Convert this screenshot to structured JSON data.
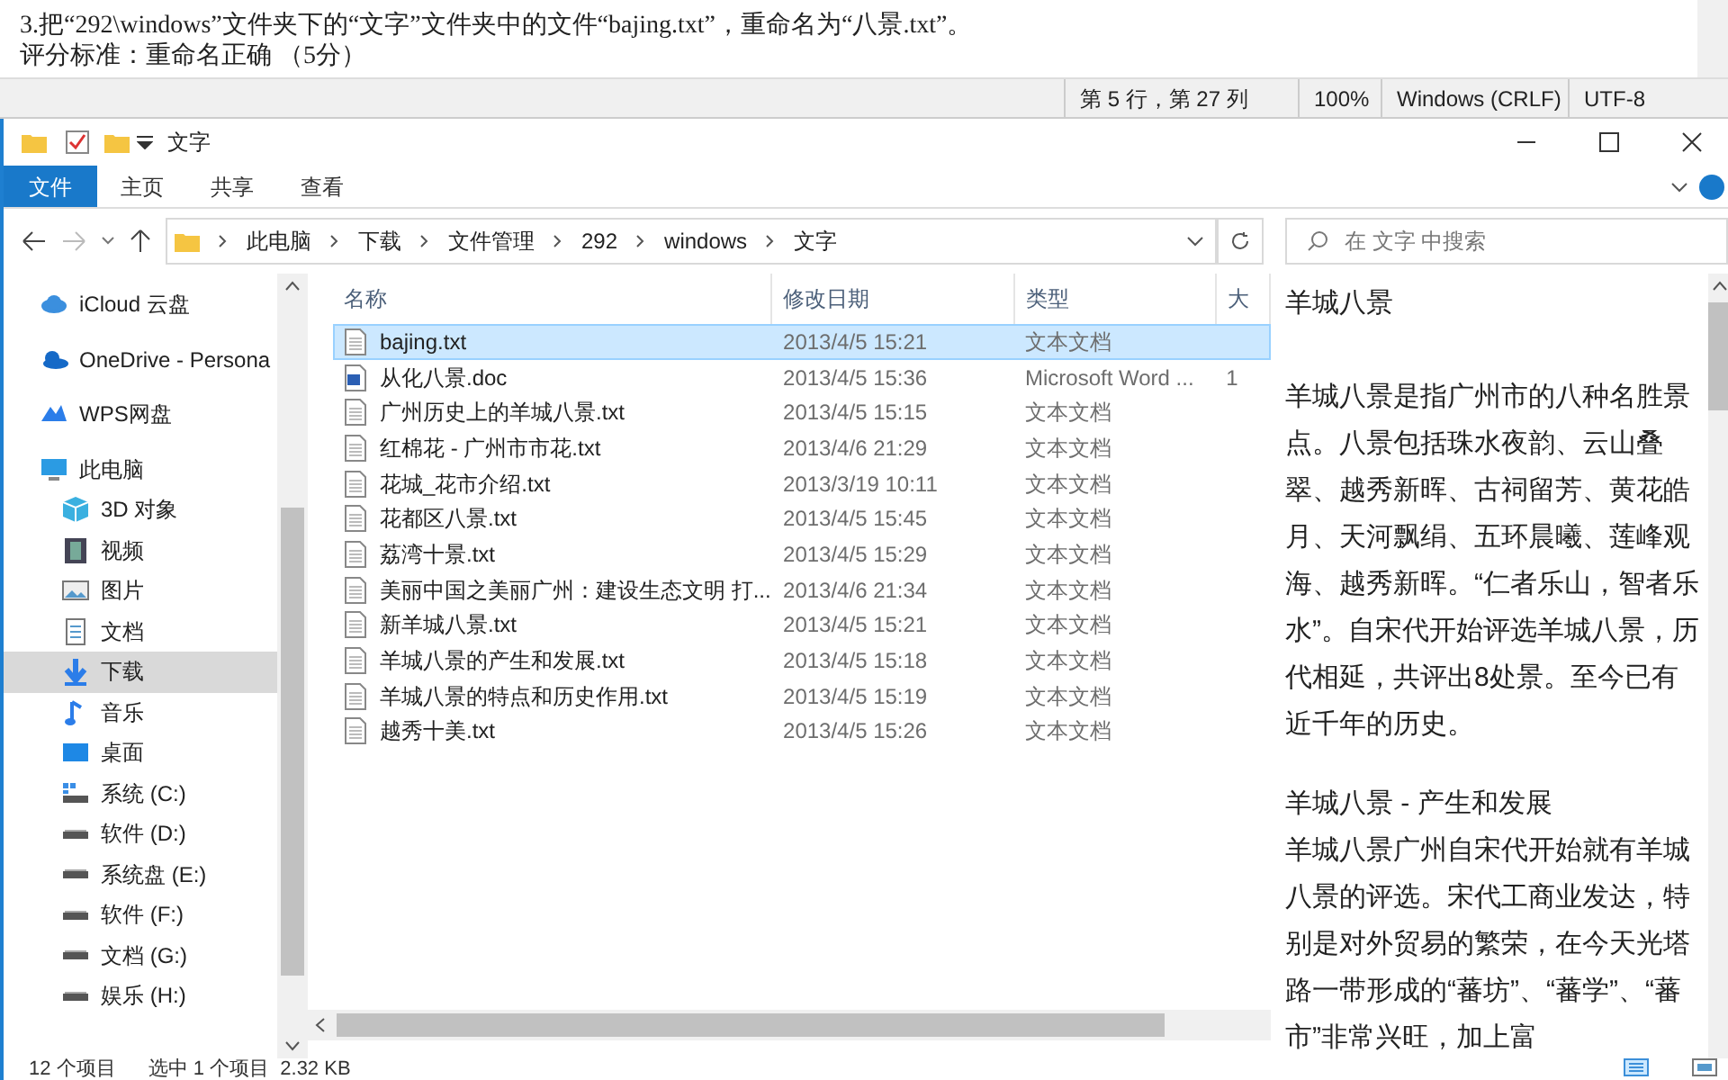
{
  "notepad": {
    "lines": [
      "3.把“292\\windows”文件夹下的“文字”文件夹中的文件“bajing.txt”，重命名为“八景.txt”。",
      "评分标准：重命名正确 （5分）"
    ],
    "status": [
      "第 5 行，第 27 列",
      "100%",
      "Windows (CRLF)",
      "UTF-8"
    ]
  },
  "window": {
    "title": "文字"
  },
  "ribbon_tabs": [
    {
      "label": "文件",
      "selected": true
    },
    {
      "label": "主页",
      "selected": false
    },
    {
      "label": "共享",
      "selected": false
    },
    {
      "label": "查看",
      "selected": false
    }
  ],
  "address": {
    "crumbs": [
      "此电脑",
      "下载",
      "文件管理",
      "292",
      "windows",
      "文字"
    ],
    "search_placeholder": "在 文字 中搜索"
  },
  "sidebar": {
    "items": [
      {
        "label": "iCloud 云盘",
        "kind": "icloud",
        "selected": false
      },
      {
        "label": "OneDrive - Persona",
        "kind": "onedrive",
        "selected": false
      },
      {
        "label": "WPS网盘",
        "kind": "wps",
        "selected": false
      },
      {
        "label": "此电脑",
        "kind": "pc",
        "selected": false,
        "children": [
          {
            "label": "3D 对象",
            "kind": "cube",
            "selected": false
          },
          {
            "label": "视频",
            "kind": "video",
            "selected": false
          },
          {
            "label": "图片",
            "kind": "pictures",
            "selected": false
          },
          {
            "label": "文档",
            "kind": "docs",
            "selected": false
          },
          {
            "label": "下载",
            "kind": "download",
            "selected": true
          },
          {
            "label": "音乐",
            "kind": "music",
            "selected": false
          },
          {
            "label": "桌面",
            "kind": "desktop",
            "selected": false
          },
          {
            "label": "系统 (C:)",
            "kind": "sysdrive",
            "selected": false
          },
          {
            "label": "软件 (D:)",
            "kind": "drive",
            "selected": false
          },
          {
            "label": "系统盘 (E:)",
            "kind": "drive",
            "selected": false
          },
          {
            "label": "软件 (F:)",
            "kind": "drive",
            "selected": false
          },
          {
            "label": "文档 (G:)",
            "kind": "drive",
            "selected": false
          },
          {
            "label": "娱乐 (H:)",
            "kind": "drive",
            "selected": false
          }
        ]
      }
    ]
  },
  "table": {
    "columns": [
      "名称",
      "修改日期",
      "类型",
      "大"
    ],
    "rows": [
      {
        "name": "bajing.txt",
        "date": "2013/4/5 15:21",
        "type": "文本文档",
        "kind": "txt",
        "selected": true
      },
      {
        "name": "从化八景.doc",
        "date": "2013/4/5 15:36",
        "type": "Microsoft Word ...",
        "size": "1",
        "kind": "doc",
        "selected": false
      },
      {
        "name": "广州历史上的羊城八景.txt",
        "date": "2013/4/5 15:15",
        "type": "文本文档",
        "kind": "txt",
        "selected": false
      },
      {
        "name": "红棉花 - 广州市市花.txt",
        "date": "2013/4/6 21:29",
        "type": "文本文档",
        "kind": "txt",
        "selected": false
      },
      {
        "name": "花城_花市介绍.txt",
        "date": "2013/3/19 10:11",
        "type": "文本文档",
        "kind": "txt",
        "selected": false
      },
      {
        "name": "花都区八景.txt",
        "date": "2013/4/5 15:45",
        "type": "文本文档",
        "kind": "txt",
        "selected": false
      },
      {
        "name": "荔湾十景.txt",
        "date": "2013/4/5 15:29",
        "type": "文本文档",
        "kind": "txt",
        "selected": false
      },
      {
        "name": "美丽中国之美丽广州：建设生态文明 打...",
        "date": "2013/4/6 21:34",
        "type": "文本文档",
        "kind": "txt",
        "selected": false
      },
      {
        "name": "新羊城八景.txt",
        "date": "2013/4/5 15:21",
        "type": "文本文档",
        "kind": "txt",
        "selected": false
      },
      {
        "name": "羊城八景的产生和发展.txt",
        "date": "2013/4/5 15:18",
        "type": "文本文档",
        "kind": "txt",
        "selected": false
      },
      {
        "name": "羊城八景的特点和历史作用.txt",
        "date": "2013/4/5 15:19",
        "type": "文本文档",
        "kind": "txt",
        "selected": false
      },
      {
        "name": "越秀十美.txt",
        "date": "2013/4/5 15:26",
        "type": "文本文档",
        "kind": "txt",
        "selected": false
      }
    ]
  },
  "preview": {
    "paragraphs": [
      {
        "kind": "title",
        "text": "羊城八景"
      },
      {
        "kind": "body",
        "text": "羊城八景是指广州市的八种名胜景点。八景包括珠水夜韵、云山叠翠、越秀新晖、古祠留芳、黄花皓月、天河飘绢、五环晨曦、莲峰观海、越秀新晖。“仁者乐山，智者乐水”。自宋代开始评选羊城八景，历代相延，共评出8处景。至今已有近千年的历史。"
      },
      {
        "kind": "heading",
        "text": "羊城八景 - 产生和发展"
      },
      {
        "kind": "body",
        "text": "羊城八景广州自宋代开始就有羊城八景的评选。宋代工商业发达，特别是对外贸易的繁荣，在今天光塔路一带形成的“蕃坊”、“蕃学”、“蕃市”非常兴旺，加上富"
      }
    ]
  },
  "status_bar": [
    "12 个项目",
    "选中 1 个项目  2.32 KB"
  ]
}
